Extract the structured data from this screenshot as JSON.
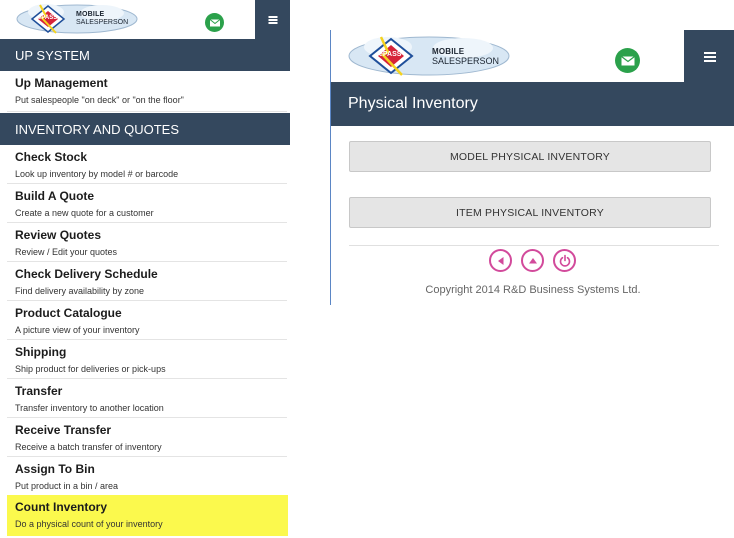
{
  "left_panel": {
    "logo": {
      "badge": "ePASS",
      "line1": "MOBILE",
      "line2": "SALESPERSON"
    },
    "icons": {
      "mail": "mail-icon",
      "menu": "hamburger-icon"
    },
    "sections": [
      {
        "header": "UP SYSTEM",
        "items": [
          {
            "title": "Up Management",
            "desc": "Put salespeople \"on deck\" or \"on the floor\""
          }
        ]
      },
      {
        "header": "INVENTORY AND QUOTES",
        "items": [
          {
            "title": "Check Stock",
            "desc": "Look up inventory by model # or barcode"
          },
          {
            "title": "Build A Quote",
            "desc": "Create a new quote for a customer"
          },
          {
            "title": "Review Quotes",
            "desc": "Review / Edit your quotes"
          },
          {
            "title": "Check Delivery Schedule",
            "desc": "Find delivery availability by zone"
          },
          {
            "title": "Product Catalogue",
            "desc": "A picture view of your inventory"
          },
          {
            "title": "Shipping",
            "desc": "Ship product for deliveries or pick-ups"
          },
          {
            "title": "Transfer",
            "desc": "Transfer inventory to another location"
          },
          {
            "title": "Receive Transfer",
            "desc": "Receive a batch transfer of inventory"
          },
          {
            "title": "Assign To Bin",
            "desc": "Put product in a bin / area"
          },
          {
            "title": "Count Inventory",
            "desc": "Do a physical count of your inventory"
          }
        ]
      }
    ],
    "highlight_color": "#fbf94d"
  },
  "right_panel": {
    "logo": {
      "badge": "ePASS",
      "line1": "MOBILE",
      "line2": "SALESPERSON"
    },
    "page_title": "Physical Inventory",
    "buttons": {
      "model": "MODEL PHYSICAL INVENTORY",
      "item": "ITEM PHYSICAL INVENTORY"
    },
    "nav_icons": [
      "back-icon",
      "up-icon",
      "power-icon"
    ],
    "copyright": "Copyright 2014 R&D Business Systems Ltd."
  },
  "colors": {
    "header_bar": "#34485e",
    "mail_green": "#2ba14b",
    "nav_magenta": "#d24a9b",
    "panel_border": "#5b86c5"
  }
}
